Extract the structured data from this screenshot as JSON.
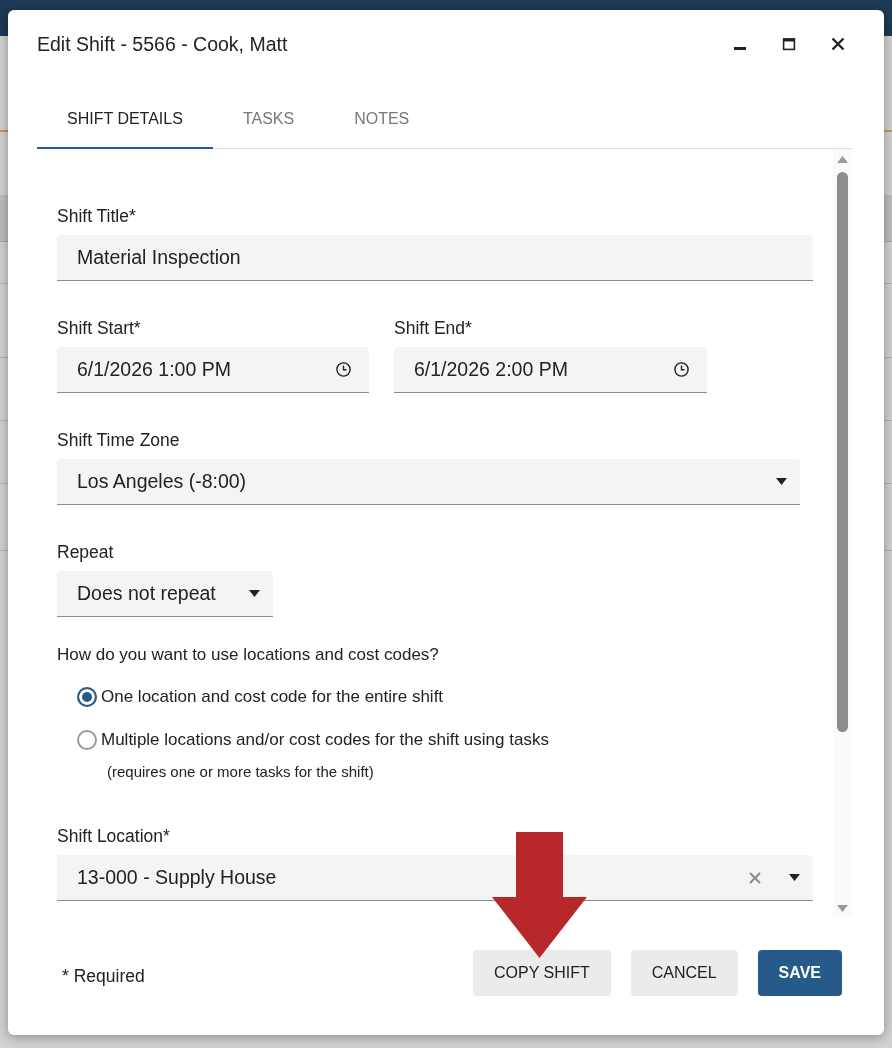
{
  "dialog": {
    "title": "Edit Shift - 5566 - Cook, Matt"
  },
  "tabs": [
    {
      "label": "SHIFT DETAILS",
      "selected": true
    },
    {
      "label": "TASKS",
      "selected": false
    },
    {
      "label": "NOTES",
      "selected": false
    }
  ],
  "form": {
    "shift_title": {
      "label": "Shift Title*",
      "value": "Material Inspection"
    },
    "shift_start": {
      "label": "Shift Start*",
      "value": "6/1/2026 1:00 PM"
    },
    "shift_end": {
      "label": "Shift End*",
      "value": "6/1/2026 2:00 PM"
    },
    "time_zone": {
      "label": "Shift Time Zone",
      "value": "Los Angeles (-8:00)"
    },
    "repeat": {
      "label": "Repeat",
      "value": "Does not repeat"
    },
    "location_mode": {
      "question": "How do you want to use locations and cost codes?",
      "options": [
        {
          "label": "One location and cost code for the entire shift",
          "selected": true
        },
        {
          "label": "Multiple locations and/or cost codes for the shift using tasks",
          "selected": false,
          "note": "(requires one or more tasks for the shift)"
        }
      ]
    },
    "shift_location": {
      "label": "Shift Location*",
      "value": "13-000 - Supply House"
    }
  },
  "footer": {
    "required_note": "* Required",
    "buttons": [
      {
        "label": "COPY SHIFT",
        "kind": "secondary"
      },
      {
        "label": "CANCEL",
        "kind": "secondary"
      },
      {
        "label": "SAVE",
        "kind": "primary"
      }
    ]
  }
}
